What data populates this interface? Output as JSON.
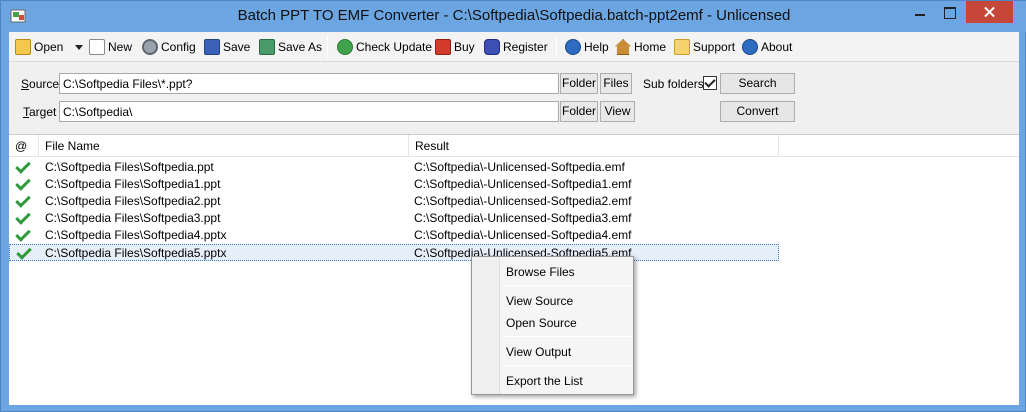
{
  "window": {
    "title": "Batch PPT TO EMF Converter - C:\\Softpedia\\Softpedia.batch-ppt2emf - Unlicensed"
  },
  "toolbar": {
    "open": "Open",
    "new": "New",
    "config": "Config",
    "save": "Save",
    "save_as": "Save As",
    "check_update": "Check Update",
    "buy": "Buy",
    "register": "Register",
    "help": "Help",
    "home": "Home",
    "support": "Support",
    "about": "About"
  },
  "source": {
    "label_u": "S",
    "label_rest": "ource",
    "value": "C:\\Softpedia Files\\*.ppt?",
    "folder_button": "Folder",
    "files_button": "Files",
    "subfolders_label": "Sub folders",
    "subfolders_checked": true,
    "search_button": "Search"
  },
  "target": {
    "label_u": "T",
    "label_rest": "arget",
    "value": "C:\\Softpedia\\",
    "folder_button": "Folder",
    "view_button": "View",
    "convert_button": "Convert"
  },
  "list": {
    "columns": [
      "@",
      "File Name",
      "Result"
    ],
    "rows": [
      {
        "status": "success",
        "file": "C:\\Softpedia Files\\Softpedia.ppt",
        "result": "C:\\Softpedia\\-Unlicensed-Softpedia.emf"
      },
      {
        "status": "success",
        "file": "C:\\Softpedia Files\\Softpedia1.ppt",
        "result": "C:\\Softpedia\\-Unlicensed-Softpedia1.emf"
      },
      {
        "status": "success",
        "file": "C:\\Softpedia Files\\Softpedia2.ppt",
        "result": "C:\\Softpedia\\-Unlicensed-Softpedia2.emf"
      },
      {
        "status": "success",
        "file": "C:\\Softpedia Files\\Softpedia3.ppt",
        "result": "C:\\Softpedia\\-Unlicensed-Softpedia3.emf"
      },
      {
        "status": "success",
        "file": "C:\\Softpedia Files\\Softpedia4.pptx",
        "result": "C:\\Softpedia\\-Unlicensed-Softpedia4.emf"
      },
      {
        "status": "success",
        "file": "C:\\Softpedia Files\\Softpedia5.pptx",
        "result": "C:\\Softpedia\\-Unlicensed-Softpedia5.emf"
      }
    ]
  },
  "context_menu": {
    "items": [
      "Browse Files",
      "View  Source",
      "Open Source",
      "View  Output",
      "Export the List"
    ]
  },
  "colors": {
    "titlebar": "#6ba6e3",
    "close_button": "#c7463a",
    "check_green": "#2e9a3c",
    "selection": "#e6eef9"
  }
}
